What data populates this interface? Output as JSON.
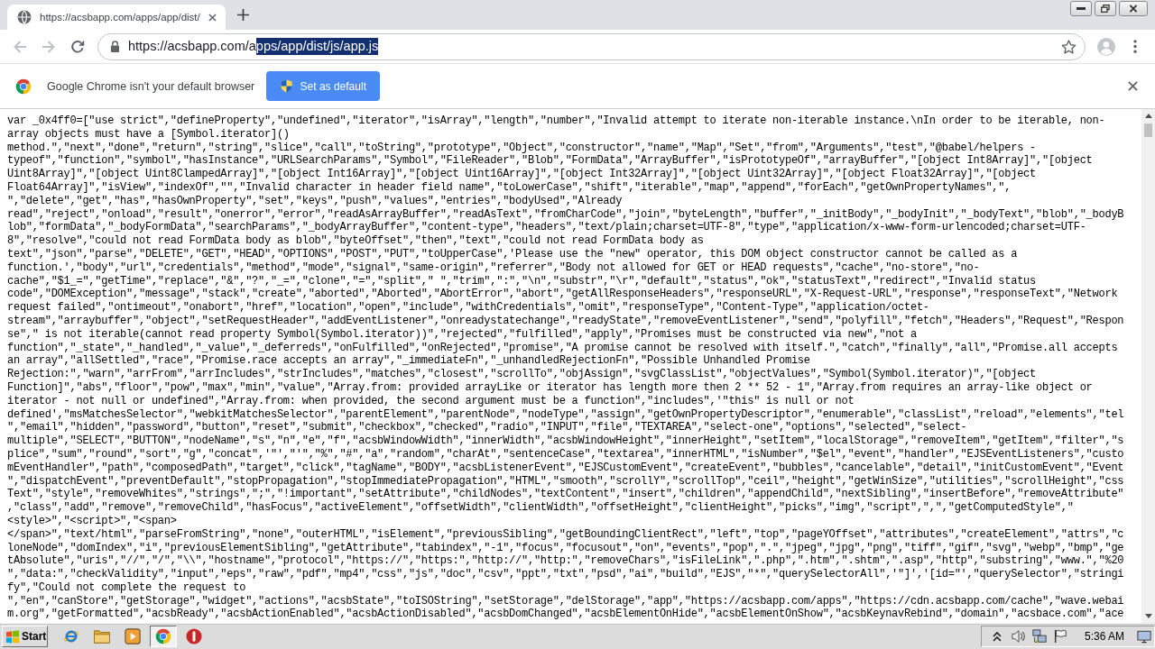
{
  "browser": {
    "tabs": [
      {
        "title": "https://acsbapp.com/apps/app/dist/",
        "selected": true
      }
    ],
    "toolbar": {
      "back_disabled": true,
      "forward_disabled": true,
      "url": [
        {
          "text": "https://acsbapp.com/a",
          "selected": false
        },
        {
          "text": "pps/app/dist/js/app.js",
          "selected": true
        }
      ]
    },
    "infobar": {
      "message": "Google Chrome isn't your default browser",
      "button": "Set as default"
    }
  },
  "page": {
    "lines": [
      "var _0x4ff0=[\"use strict\",\"defineProperty\",\"undefined\",\"iterator\",\"isArray\",\"length\",\"number\",\"Invalid attempt to iterate non-iterable instance.\\nIn order to be iterable, non-",
      "array objects must have a [Symbol.iterator]()",
      "method.\",\"next\",\"done\",\"return\",\"string\",\"slice\",\"call\",\"toString\",\"prototype\",\"Object\",\"constructor\",\"name\",\"Map\",\"Set\",\"from\",\"Arguments\",\"test\",\"@babel/helpers -",
      "typeof\",\"function\",\"symbol\",\"hasInstance\",\"URLSearchParams\",\"Symbol\",\"FileReader\",\"Blob\",\"FormData\",\"ArrayBuffer\",\"isPrototypeOf\",\"arrayBuffer\",\"[object Int8Array]\",\"[object",
      "Uint8Array]\",\"[object Uint8ClampedArray]\",\"[object Int16Array]\",\"[object Uint16Array]\",\"[object Int32Array]\",\"[object Uint32Array]\",\"[object Float32Array]\",\"[object",
      "Float64Array]\",\"isView\",\"indexOf\",\"\",\"Invalid character in header field name\",\"toLowerCase\",\"shift\",\"iterable\",\"map\",\"append\",\"forEach\",\"getOwnPropertyNames\",\",",
      "\",\"delete\",\"get\",\"has\",\"hasOwnProperty\",\"set\",\"keys\",\"push\",\"values\",\"entries\",\"bodyUsed\",\"Already",
      "read\",\"reject\",\"onload\",\"result\",\"onerror\",\"error\",\"readAsArrayBuffer\",\"readAsText\",\"fromCharCode\",\"join\",\"byteLength\",\"buffer\",\"_initBody\",\"_bodyInit\",\"_bodyText\",\"blob\",\"_bodyB",
      "lob\",\"formData\",\"_bodyFormData\",\"searchParams\",\"_bodyArrayBuffer\",\"content-type\",\"headers\",\"text/plain;charset=UTF-8\",\"type\",\"application/x-www-form-urlencoded;charset=UTF-",
      "8\",\"resolve\",\"could not read FormData body as blob\",\"byteOffset\",\"then\",\"text\",\"could not read FormData body as",
      "text\",\"json\",\"parse\",\"DELETE\",\"GET\",\"HEAD\",\"OPTIONS\",\"POST\",\"PUT\",\"toUpperCase\",'Please use the \"new\" operator, this DOM object constructor cannot be called as a",
      "function.',\"body\",\"url\",\"credentials\",\"method\",\"mode\",\"signal\",\"same-origin\",\"referrer\",\"Body not allowed for GET or HEAD requests\",\"cache\",\"no-store\",\"no-",
      "cache\",\"$1_=\",\"getTime\",\"replace\",\"&\",\"?\",\"_=\",\"clone\",\"=\",\"split\",\" \",\"trim\",\":\",\"\\n\",\"substr\",\"\\r\",\"default\",\"status\",\"ok\",\"statusText\",\"redirect\",\"Invalid status",
      "code\",\"DOMException\",\"message\",\"stack\",\"create\",\"aborted\",\"Aborted\",\"AbortError\",\"abort\",\"getAllResponseHeaders\",\"responseURL\",\"X-Request-URL\",\"response\",\"responseText\",\"Network",
      "request failed\",\"ontimeout\",\"onabort\",\"href\",\"location\",\"open\",\"include\",\"withCredentials\",\"omit\",\"responseType\",\"Content-Type\",\"application/octet-",
      "stream\",\"arraybuffer\",\"object\",\"setRequestHeader\",\"addEventListener\",\"onreadystatechange\",\"readyState\",\"removeEventListener\",\"send\",\"polyfill\",\"fetch\",\"Headers\",\"Request\",\"Respon",
      "se\",\" is not iterable(cannot read property Symbol(Symbol.iterator))\",\"rejected\",\"fulfilled\",\"apply\",\"Promises must be constructed via new\",\"not a",
      "function\",\"_state\",\"_handled\",\"_value\",\"_deferreds\",\"onFulfilled\",\"onRejected\",\"promise\",\"A promise cannot be resolved with itself.\",\"catch\",\"finally\",\"all\",\"Promise.all accepts",
      "an array\",\"allSettled\",\"race\",\"Promise.race accepts an array\",\"_immediateFn\",\"_unhandledRejectionFn\",\"Possible Unhandled Promise",
      "Rejection:\",\"warn\",\"arrFrom\",\"arrIncludes\",\"strIncludes\",\"matches\",\"closest\",\"scrollTo\",\"objAssign\",\"svgClassList\",\"objectValues\",\"Symbol(Symbol.iterator)\",\"[object",
      "Function]\",\"abs\",\"floor\",\"pow\",\"max\",\"min\",\"value\",\"Array.from: provided arrayLike or iterator has length more then 2 ** 52 - 1\",\"Array.from requires an array-like object or",
      "iterator - not null or undefined\",\"Array.from: when provided, the second argument must be a function\",\"includes\",'\"this\" is null or not",
      "defined',\"msMatchesSelector\",\"webkitMatchesSelector\",\"parentElement\",\"parentNode\",\"nodeType\",\"assign\",\"getOwnPropertyDescriptor\",\"enumerable\",\"classList\",\"reload\",\"elements\",\"tel",
      "\",\"email\",\"hidden\",\"password\",\"button\",\"reset\",\"submit\",\"checkbox\",\"checked\",\"radio\",\"INPUT\",\"file\",\"TEXTAREA\",\"select-one\",\"options\",\"selected\",\"select-",
      "multiple\",\"SELECT\",\"BUTTON\",\"nodeName\",\"s\",\"n\",\"e\",\"f\",\"acsbWindowWidth\",\"innerWidth\",\"acsbWindowHeight\",\"innerHeight\",\"setItem\",\"localStorage\",\"removeItem\",\"getItem\",\"filter\",\"s",
      "plice\",\"sum\",\"round\",\"sort\",\"g\",\"concat\",'\"',\"'\",\"%\",\"#\",\"a\",\"random\",\"charAt\",\"sentenceCase\",\"textarea\",\"innerHTML\",\"isNumber\",\"$el\",\"event\",\"handler\",\"EJSEventListeners\",\"custo",
      "mEventHandler\",\"path\",\"composedPath\",\"target\",\"click\",\"tagName\",\"BODY\",\"acsbListenerEvent\",\"EJSCustomEvent\",\"createEvent\",\"bubbles\",\"cancelable\",\"detail\",\"initCustomEvent\",\"Event",
      "\",\"dispatchEvent\",\"preventDefault\",\"stopPropagation\",\"stopImmediatePropagation\",\"HTML\",\"smooth\",\"scrollY\",\"scrollTop\",\"ceil\",\"height\",\"getWinSize\",\"utilities\",\"scrollHeight\",\"css",
      "Text\",\"style\",\"removeWhites\",\"strings\",\";\",\"!important\",\"setAttribute\",\"childNodes\",\"textContent\",\"insert\",\"children\",\"appendChild\",\"nextSibling\",\"insertBefore\",\"removeAttribute\"",
      ",\"class\",\"add\",\"remove\",\"removeChild\",\"hasFocus\",\"activeElement\",\"offsetWidth\",\"clientWidth\",\"offsetHeight\",\"clientHeight\",\"picks\",\"img\",\"script\",\",\",\"getComputedStyle\",\"",
      "<style>\",\"<script>\",\"<span>",
      "</span>\",\"text/html\",\"parseFromString\",\"none\",\"outerHTML\",\"isElement\",\"previousSibling\",\"getBoundingClientRect\",\"left\",\"top\",\"pageYOffset\",\"attributes\",\"createElement\",\"attrs\",\"c",
      "loneNode\",\"domIndex\",\"i\",\"previousElementSibling\",\"getAttribute\",\"tabindex\",\"-1\",\"focus\",\"focusout\",\"on\",\"events\",\"pop\",\".\",\"jpeg\",\"jpg\",\"png\",\"tiff\",\"gif\",\"svg\",\"webp\",\"bmp\",\"ge",
      "tAbsolute\",\"uris\",\"//\",\"/\",\"\\\\\",\"hostname\",\"protocol\",\"https://\",\"https:\",\"http://\",\"http:\",\"removeChars\",\"isFileLink\",\".php\",\".htm\",\".shtm\",\".asp\",\"http\",\"substring\",\"www.\",\"%20",
      "\",\"data:\",\"checkValidity\",\"input\",\"eps\",\"raw\",\"pdf\",\"mp4\",\"css\",\"js\",\"doc\",\"csv\",\"ppt\",\"txt\",\"psd\",\"ai\",\"build\",\"EJS\",\"*\",\"querySelectorAll\",'\"]','[id=\"',\"querySelector\",\"stringi",
      "fy\",\"Could not complete the request to",
      "\",\"en\",\"canStore\",\"getStorage\",\"widget\",\"actions\",\"acsbState\",\"toISOString\",\"setStorage\",\"delStorage\",\"app\",\"https://acsbapp.com/apps\",\"https://cdn.acsbapp.com/cache\",\"wave.webai",
      "m.org\",\"getFormatted\",\"acsbReady\",\"acsbActionEnabled\",\"acsbActionDisabled\",\"acsbDomChanged\",\"acsbElementOnHide\",\"acsbElementOnShow\",\"acsbKeynavRebind\",\"domain\",\"acsbace.com\",\"ace"
    ]
  },
  "taskbar": {
    "start": "Start",
    "apps": [
      {
        "kind": "ie",
        "selected": false
      },
      {
        "kind": "folder",
        "selected": false
      },
      {
        "kind": "media",
        "selected": false
      },
      {
        "kind": "chrome",
        "selected": true
      },
      {
        "kind": "circle",
        "selected": false
      }
    ],
    "clock": "5:36 AM"
  }
}
